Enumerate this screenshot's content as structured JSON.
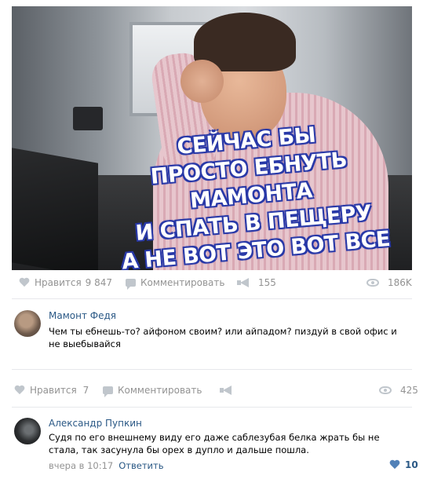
{
  "post": {
    "caption": [
      "СЕЙЧАС БЫ",
      "ПРОСТО ЕБНУТЬ МАМОНТА",
      "И СПАТЬ В ПЕЩЕРУ",
      "А НЕ ВОТ ЭТО ВОТ ВСЕ"
    ],
    "actions": {
      "like_label": "Нравится",
      "like_count": "9 847",
      "comment_label": "Комментировать",
      "share_count": "155",
      "views": "186K"
    }
  },
  "comment1": {
    "author": "Мамонт Федя",
    "text": "Чем ты ебнешь-то? айфоном своим? или айпадом? пиздуй в свой офис и не выебывайся",
    "actions": {
      "like_label": "Нравится",
      "like_count": "7",
      "comment_label": "Комментировать",
      "views": "425"
    }
  },
  "comment2": {
    "author": "Александр Пупкин",
    "text": "Судя по его внешнему виду его даже саблезубая белка жрать бы не стала, так засунула бы орех в дупло и дальше пошла.",
    "time": "вчера в 10:17",
    "reply_label": "Ответить",
    "likes": "10"
  },
  "icons": {
    "like": "heart-icon",
    "comment": "comment-icon",
    "share": "megaphone-icon",
    "views": "eye-icon"
  },
  "colors": {
    "link": "#2a5885",
    "muted": "#939393",
    "icon": "#c0c6cc",
    "caption_outline": "#2a3aa8"
  }
}
